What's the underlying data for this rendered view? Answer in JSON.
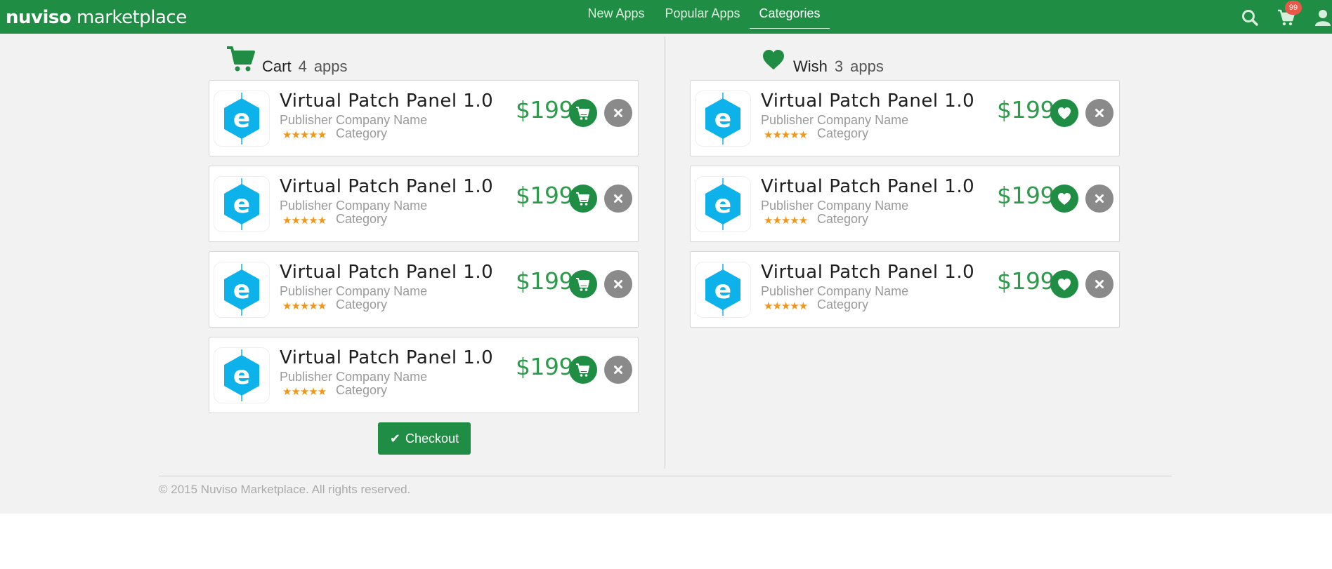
{
  "brand": {
    "part1": "nuviso",
    "part2": " marketplace"
  },
  "nav": {
    "tabs": [
      {
        "label": "New Apps"
      },
      {
        "label": "Popular Apps"
      },
      {
        "label": "Categories",
        "active": true
      }
    ],
    "cart_badge": "99",
    "icons": [
      "search-icon",
      "cart-icon",
      "user-icon"
    ]
  },
  "cart": {
    "title": "Cart",
    "count": "4",
    "unit": "apps",
    "items": [
      {
        "name": "Virtual Patch Panel 1.0",
        "publisher": "Publisher Company Name",
        "stars": "★★★★★",
        "rating": 5,
        "category": "Category",
        "price": "$199"
      },
      {
        "name": "Virtual Patch Panel 1.0",
        "publisher": "Publisher Company Name",
        "stars": "★★★★★",
        "rating": 5,
        "category": "Category",
        "price": "$199"
      },
      {
        "name": "Virtual Patch Panel 1.0",
        "publisher": "Publisher Company Name",
        "stars": "★★★★★",
        "rating": 5,
        "category": "Category",
        "price": "$199"
      },
      {
        "name": "Virtual Patch Panel 1.0",
        "publisher": "Publisher Company Name",
        "stars": "★★★★★",
        "rating": 5,
        "category": "Category",
        "price": "$199"
      }
    ],
    "checkout_label": "Checkout"
  },
  "wish": {
    "title": "Wish",
    "count": "3",
    "unit": "apps",
    "items": [
      {
        "name": "Virtual Patch Panel 1.0",
        "publisher": "Publisher Company Name",
        "stars": "★★★★★",
        "rating": 5,
        "category": "Category",
        "price": "$199"
      },
      {
        "name": "Virtual Patch Panel 1.0",
        "publisher": "Publisher Company Name",
        "stars": "★★★★★",
        "rating": 5,
        "category": "Category",
        "price": "$199"
      },
      {
        "name": "Virtual Patch Panel 1.0",
        "publisher": "Publisher Company Name",
        "stars": "★★★★★",
        "rating": 5,
        "category": "Category",
        "price": "$199"
      }
    ]
  },
  "footer": {
    "text": "© 2015 Nuviso Marketplace. All rights reserved."
  },
  "colors": {
    "brand_green": "#1f8d43",
    "price_green": "#2e9a4c",
    "icon_blue": "#0eb2ea",
    "star_orange": "#f2961a",
    "badge_red": "#e8594a",
    "remove_grey": "#8a8a8a"
  }
}
